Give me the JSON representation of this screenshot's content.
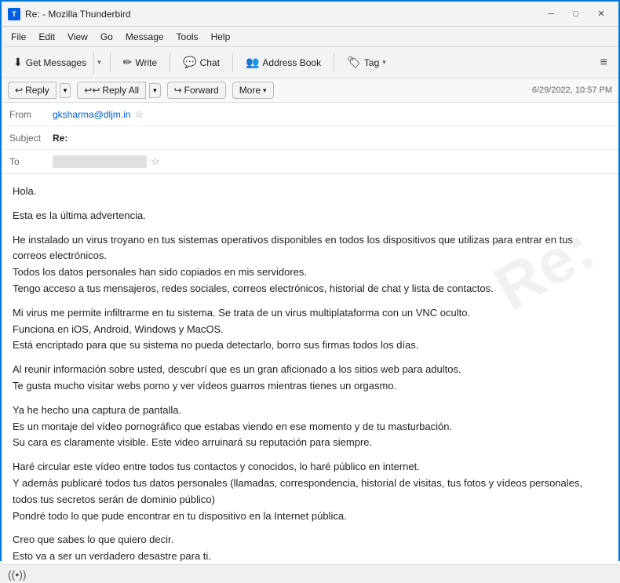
{
  "titlebar": {
    "title": "Re: - Mozilla Thunderbird",
    "min_label": "─",
    "max_label": "□",
    "close_label": "✕"
  },
  "menubar": {
    "items": [
      "File",
      "Edit",
      "View",
      "Go",
      "Message",
      "Tools",
      "Help"
    ]
  },
  "toolbar": {
    "get_messages_label": "Get Messages",
    "write_label": "Write",
    "chat_label": "Chat",
    "address_book_label": "Address Book",
    "tag_label": "Tag",
    "menu_icon": "≡"
  },
  "action_row": {
    "reply_label": "Reply",
    "reply_all_label": "Reply All",
    "forward_label": "Forward",
    "more_label": "More",
    "date": "6/29/2022, 10:57 PM"
  },
  "email": {
    "from_label": "From",
    "from_value": "gksharma@dljm.in",
    "subject_label": "Subject",
    "subject_value": "Re:",
    "to_label": "To",
    "to_value": ""
  },
  "body": {
    "paragraphs": [
      "Hola.",
      "Esta es la última advertencia.",
      "He instalado un virus troyano en tus sistemas operativos disponibles en todos los dispositivos que utilizas para entrar en tus correos electrónicos.\nTodos los datos personales han sido copiados en mis servidores.\nTengo acceso a tus mensajeros, redes sociales, correos electrónicos, historial de chat y lista de contactos.",
      "Mi virus me permite infiltrarme en tu sistema. Se trata de un virus multiplataforma con un VNC oculto.\nFunciona en iOS, Android, Windows y MacOS.\nEstá encriptado para que su sistema no pueda detectarlo, borro sus firmas todos los días.",
      "Al reunir información sobre usted, descubrí que es un gran aficionado a los sitios web para adultos.\nTe gusta mucho visitar webs porno y ver vídeos guarros mientras tienes un orgasmo.",
      "Ya he hecho una captura de pantalla.\nEs un montaje del vídeo pornográfico que estabas viendo en ese momento y de tu masturbación.\nSu cara es claramente visible. Este video arruinará su reputación para siempre.",
      "Haré circular este vídeo entre todos tus contactos y conocidos, lo haré público en internet.\nY además publicaré todos tus datos personales (llamadas, correspondencia, historial de visitas, tus fotos y vídeos personales, todos tus secretos serán de dominio público)\nPondré todo lo que pude encontrar en tu dispositivo en la Internet pública.",
      "Creo que sabes lo que quiero decir.\nEsto va a ser un verdadero desastre para ti."
    ]
  },
  "statusbar": {
    "icon": "((•))",
    "text": ""
  }
}
